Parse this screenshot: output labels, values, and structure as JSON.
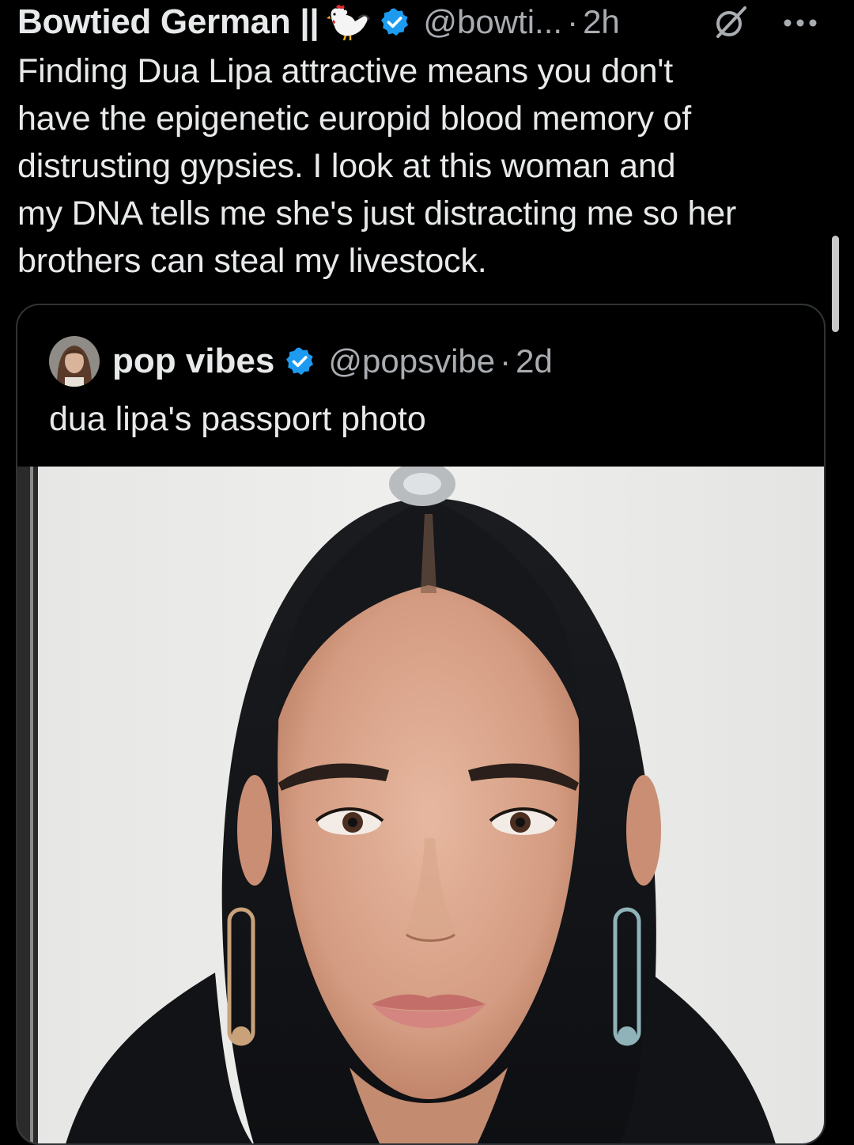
{
  "tweet": {
    "display_name": "Bowtied German ||",
    "handle": "@bowti...",
    "separator": "·",
    "time": "2h",
    "text": "Finding Dua Lipa attractive means you don't\nhave the epigenetic europid blood memory of\ndistrusting gypsies.  I look at this woman and\nmy DNA tells me she's just distracting me so her\nbrothers can steal my livestock.",
    "icons": [
      "rooster-icon",
      "verified-badge-icon",
      "grok-icon",
      "more-icon"
    ]
  },
  "quote": {
    "display_name": "pop vibes",
    "handle": "@popsvibe",
    "separator": "·",
    "time": "2d",
    "text": "dua lipa's passport photo",
    "icons": [
      "avatar",
      "verified-badge-icon"
    ]
  },
  "colors": {
    "background": "#000000",
    "text_primary": "#e7e9ea",
    "text_secondary": "#a9adb2",
    "verified_blue": "#1d9bf0",
    "border": "#2f3336"
  }
}
